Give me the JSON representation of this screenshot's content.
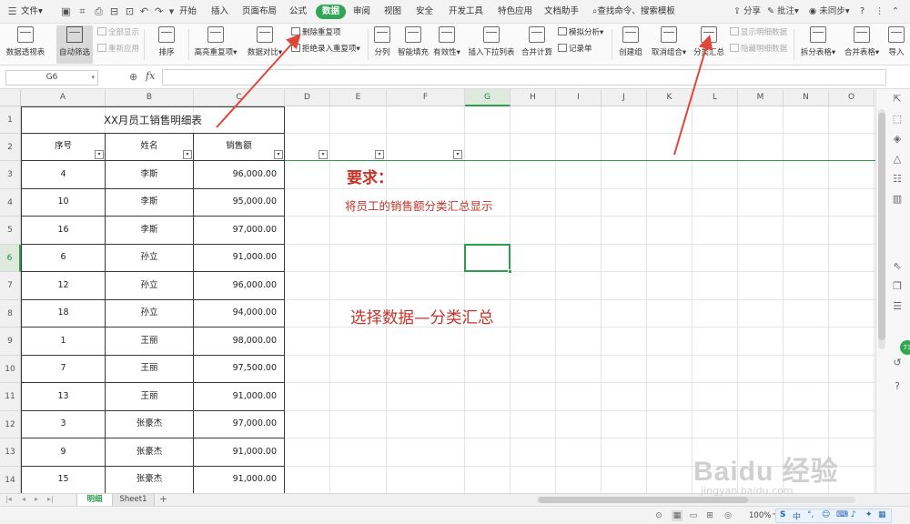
{
  "menubar": {
    "file_label": "文件",
    "file_arrow": "▾",
    "quick_icons": [
      "save-icon",
      "format-painter-icon",
      "print-icon",
      "export-pdf-icon",
      "preview-icon",
      "undo-icon",
      "redo-icon",
      "dropdown-icon"
    ],
    "tabs": [
      "开始",
      "插入",
      "页面布局",
      "公式",
      "数据",
      "审阅",
      "视图",
      "安全",
      "开发工具",
      "特色应用",
      "文档助手"
    ],
    "active_tab": "数据",
    "search_label": "查找命令、搜索模板",
    "share_label": "分享",
    "comment_label": "批注",
    "sync_label": "未同步",
    "help_label": "?"
  },
  "ribbon": {
    "pivot_label": "数据透视表",
    "autofilter_label": "自动筛选",
    "show_all_label": "全部显示",
    "reapply_label": "重新应用",
    "sort_label": "排序",
    "highlight_dup_label": "高亮重复项",
    "compare_label": "数据对比",
    "remove_dup_label": "删除重复项",
    "reject_dup_label": "拒绝录入重复项",
    "split_label": "分列",
    "smart_fill_label": "智能填充",
    "validity_label": "有效性",
    "insert_dropdown_label": "插入下拉列表",
    "consolidate_label": "合并计算",
    "simulate_label": "模拟分析",
    "record_label": "记录单",
    "group_label": "创建组",
    "ungroup_label": "取消组合",
    "subtotal_label": "分类汇总",
    "show_detail_label": "显示明细数据",
    "hide_detail_label": "隐藏明细数据",
    "split_table_label": "拆分表格",
    "merge_table_label": "合并表格",
    "import_label": "导入"
  },
  "formula_bar": {
    "name_box": "G6",
    "fx_label": "fx",
    "content": ""
  },
  "sheet": {
    "columns": [
      "A",
      "B",
      "C",
      "D",
      "E",
      "F",
      "G",
      "H",
      "I",
      "J",
      "K",
      "L",
      "M",
      "N",
      "O"
    ],
    "selected_column": "G",
    "rows": [
      "1",
      "2",
      "3",
      "4",
      "5",
      "6",
      "7",
      "8",
      "9",
      "10",
      "11",
      "12",
      "13",
      "14"
    ],
    "selected_row": "6",
    "selected_cell": "G6",
    "title": "XX月员工销售明细表",
    "headers": [
      "序号",
      "姓名",
      "销售额"
    ],
    "data": [
      [
        "4",
        "李斯",
        "96,000.00"
      ],
      [
        "10",
        "李斯",
        "95,000.00"
      ],
      [
        "16",
        "李斯",
        "97,000.00"
      ],
      [
        "6",
        "孙立",
        "91,000.00"
      ],
      [
        "12",
        "孙立",
        "96,000.00"
      ],
      [
        "18",
        "孙立",
        "94,000.00"
      ],
      [
        "1",
        "王丽",
        "98,000.00"
      ],
      [
        "7",
        "王丽",
        "97,500.00"
      ],
      [
        "13",
        "王丽",
        "91,000.00"
      ],
      [
        "3",
        "张豪杰",
        "97,000.00"
      ],
      [
        "9",
        "张豪杰",
        "91,000.00"
      ],
      [
        "15",
        "张豪杰",
        "91,000.00"
      ]
    ],
    "filter_glyph": "▾"
  },
  "annotations": {
    "requirement_title": "要求：",
    "requirement_text": "将员工的销售额分类汇总显示",
    "instruction": "选择数据—分类汇总",
    "color": "#c4342b"
  },
  "sheet_tabs": {
    "tabs": [
      "明细",
      "Sheet1"
    ],
    "active": "明细",
    "add_label": "+"
  },
  "side_panel": {
    "badge": "73"
  },
  "status_bar": {
    "zoom": "100%",
    "ime": [
      "S",
      "中",
      "°,",
      "☺",
      "⌨",
      "♪",
      "✦",
      "▦"
    ]
  },
  "watermark": {
    "line1": "Baidu 经验",
    "line2": "jingyan.baidu.com"
  },
  "colors": {
    "accent": "#31a556",
    "selection": "#2e9e4e",
    "annotation_red": "#c4342b"
  }
}
